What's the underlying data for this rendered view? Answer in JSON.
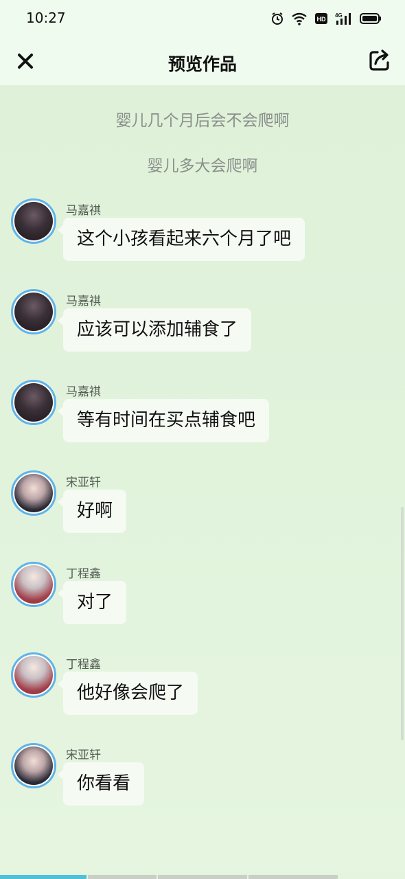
{
  "status_bar": {
    "time": "10:27"
  },
  "header": {
    "title": "预览作品",
    "close_icon": "close-icon",
    "share_icon": "share-icon"
  },
  "narrations": [
    "婴儿几个月后会不会爬啊",
    "婴儿多大会爬啊"
  ],
  "messages": [
    {
      "sender": "马嘉祺",
      "text": "这个小孩看起来六个月了吧",
      "avatar": "a"
    },
    {
      "sender": "马嘉祺",
      "text": "应该可以添加辅食了",
      "avatar": "a"
    },
    {
      "sender": "马嘉祺",
      "text": "等有时间在买点辅食吧",
      "avatar": "a"
    },
    {
      "sender": "宋亚轩",
      "text": "好啊",
      "avatar": "b"
    },
    {
      "sender": "丁程鑫",
      "text": "对了",
      "avatar": "c"
    },
    {
      "sender": "丁程鑫",
      "text": "他好像会爬了",
      "avatar": "c"
    },
    {
      "sender": "宋亚轩",
      "text": "你看看",
      "avatar": "b"
    }
  ],
  "colors": {
    "background": "#e4f4df",
    "header": "#f0fbef",
    "bubble": "#f5faf3",
    "avatar_ring": "#5fb3ea",
    "progress_active": "#4fc1d6"
  }
}
